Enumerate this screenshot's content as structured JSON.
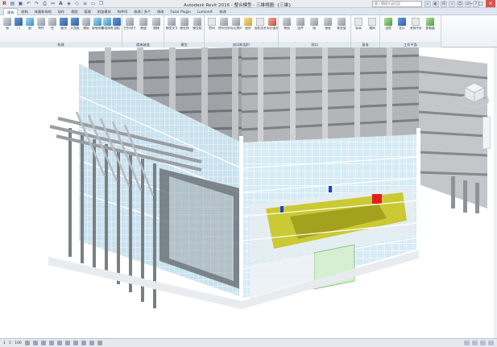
{
  "window": {
    "title": "Autodesk Revit 2016 -    整合模型 - 三維視圖: {三維}",
    "search_placeholder": "鍵入關鍵字或短語",
    "minimize": "–",
    "maximize": "□",
    "close": "×"
  },
  "qat_icons": [
    "revit-logo-icon",
    "open-icon",
    "save-icon",
    "undo-icon",
    "redo-icon",
    "print-icon",
    "measure-icon",
    "text-icon",
    "3d-view-icon",
    "section-icon",
    "thin-lines-icon",
    "close-hidden-icon",
    "switch-windows-icon"
  ],
  "tabs": [
    "建筑",
    "结构",
    "系统",
    "插入",
    "注释",
    "分析",
    "体量和场地",
    "协作",
    "视图",
    "管理",
    "附加模块",
    "构件坞",
    "修改",
    "Fuzor Plugin",
    "Lumion®",
    "修改"
  ],
  "tabs_display": [
    "建筑",
    "结构",
    "体量和场地",
    "协作",
    "视图",
    "管理",
    "附加模块",
    "构件坞",
    "修改 | 多个",
    "修改",
    "Fuzor Plugin",
    "Lumion®",
    "修改"
  ],
  "active_tab_index": 0,
  "ribbon": {
    "panels": [
      {
        "title": "构建",
        "tools": [
          {
            "label": "墙",
            "icon": "wall-icon"
          },
          {
            "label": "门",
            "icon": "door-icon"
          },
          {
            "label": "窗",
            "icon": "window-icon"
          },
          {
            "label": "构件",
            "icon": "component-icon"
          },
          {
            "label": "柱",
            "icon": "column-icon"
          },
          {
            "label": "屋顶",
            "icon": "roof-icon"
          },
          {
            "label": "天花板",
            "icon": "ceiling-icon"
          },
          {
            "label": "楼板",
            "icon": "floor-icon"
          },
          {
            "label": "幕墙系统",
            "icon": "curtain-system-icon"
          },
          {
            "label": "幕墙网格",
            "icon": "curtain-grid-icon"
          },
          {
            "label": "竖梃",
            "icon": "mullion-icon"
          }
        ]
      },
      {
        "title": "楼梯坡道",
        "tools": [
          {
            "label": "栏杆扶手",
            "icon": "railing-icon"
          },
          {
            "label": "坡道",
            "icon": "ramp-icon"
          },
          {
            "label": "楼梯",
            "icon": "stair-icon"
          }
        ]
      },
      {
        "title": "模型",
        "tools": [
          {
            "label": "模型文字",
            "icon": "model-text-icon"
          },
          {
            "label": "模型线",
            "icon": "model-line-icon"
          },
          {
            "label": "模型组",
            "icon": "model-group-icon"
          }
        ]
      },
      {
        "title": "房间和面积",
        "tools": [
          {
            "label": "房间",
            "icon": "room-icon"
          },
          {
            "label": "房间分隔",
            "icon": "room-separator-icon"
          },
          {
            "label": "标记房间",
            "icon": "tag-room-icon"
          },
          {
            "label": "面积",
            "icon": "area-icon"
          },
          {
            "label": "面积边界",
            "icon": "area-boundary-icon"
          },
          {
            "label": "标记面积",
            "icon": "tag-area-icon"
          }
        ]
      },
      {
        "title": "洞口",
        "tools": [
          {
            "label": "按面",
            "icon": "by-face-icon"
          },
          {
            "label": "竖井",
            "icon": "shaft-icon"
          },
          {
            "label": "墙",
            "icon": "wall-opening-icon"
          },
          {
            "label": "垂直",
            "icon": "vertical-icon"
          },
          {
            "label": "老虎窗",
            "icon": "dormer-icon"
          }
        ]
      },
      {
        "title": "基准",
        "tools": [
          {
            "label": "标高",
            "icon": "level-icon"
          },
          {
            "label": "轴网",
            "icon": "grid-icon"
          }
        ]
      },
      {
        "title": "工作平面",
        "tools": [
          {
            "label": "设置",
            "icon": "set-icon"
          },
          {
            "label": "显示",
            "icon": "show-icon"
          },
          {
            "label": "参照平面",
            "icon": "ref-plane-icon"
          },
          {
            "label": "查看器",
            "icon": "viewer-icon"
          }
        ]
      }
    ]
  },
  "status": {
    "scale_prefix": "1",
    "scale": "1 : 100",
    "icons": [
      "detail-level-icon",
      "visual-style-icon",
      "sun-path-icon",
      "shadows-icon",
      "crop-icon",
      "show-crop-icon",
      "temp-hide-icon",
      "reveal-icon",
      "analytical-icon",
      "highlight-icon"
    ]
  },
  "colors": {
    "concrete": "#a7aaae",
    "concrete_dark": "#7d8085",
    "glass": "#cfe6f2",
    "mullion": "#f4f6f7",
    "yellow_equipment": "#c9c629",
    "red_box": "#e02020",
    "blue_marker": "#1f3fd6"
  }
}
